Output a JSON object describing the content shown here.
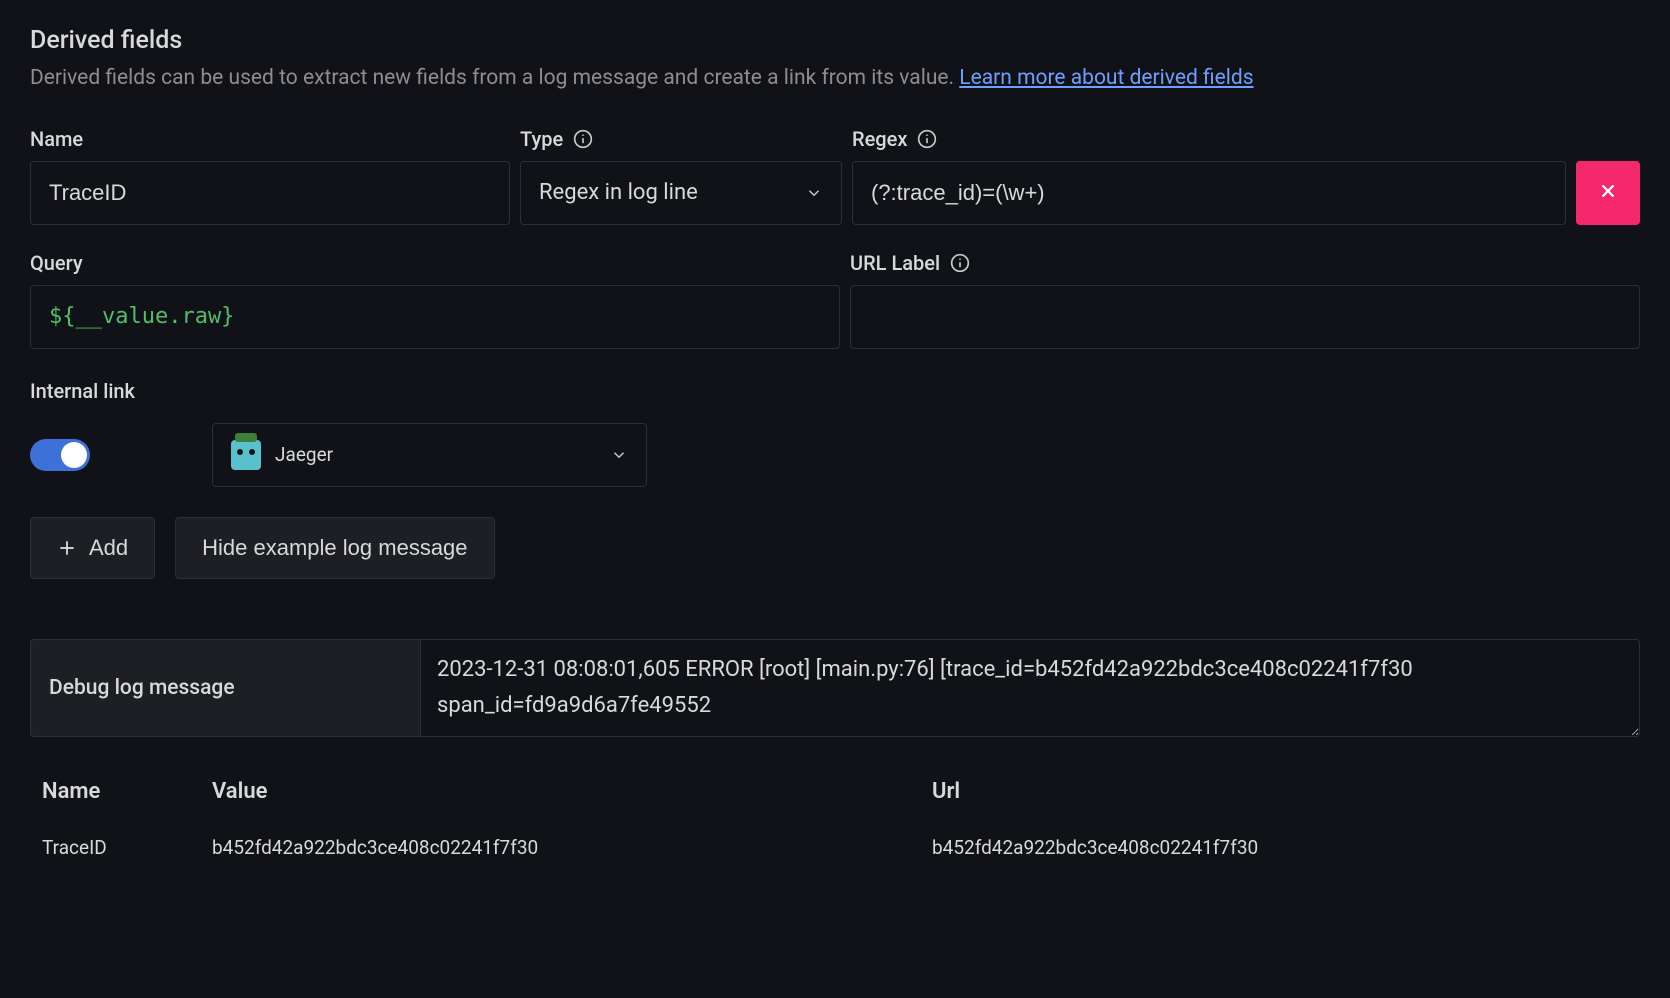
{
  "section": {
    "title": "Derived fields",
    "description": "Derived fields can be used to extract new fields from a log message and create a link from its value. ",
    "learn_link": "Learn more about derived fields"
  },
  "labels": {
    "name": "Name",
    "type": "Type",
    "regex": "Regex",
    "query": "Query",
    "url_label": "URL Label",
    "internal_link": "Internal link",
    "debug_log_message": "Debug log message"
  },
  "fields": {
    "name_value": "TraceID",
    "type_value": "Regex in log line",
    "regex_value": "(?:trace_id)=(\\w+)",
    "query_value": "${__value.raw}",
    "url_label_value": "",
    "internal_link_on": true,
    "datasource": "Jaeger"
  },
  "buttons": {
    "add": "Add",
    "hide_example": "Hide example log message"
  },
  "debug_message": "2023-12-31 08:08:01,605 ERROR [root] [main.py:76] [trace_id=b452fd42a922bdc3ce408c02241f7f30 span_id=fd9a9d6a7fe49552",
  "table": {
    "headers": {
      "name": "Name",
      "value": "Value",
      "url": "Url"
    },
    "rows": [
      {
        "name": "TraceID",
        "value": "b452fd42a922bdc3ce408c02241f7f30",
        "url": "b452fd42a922bdc3ce408c02241f7f30"
      }
    ]
  }
}
